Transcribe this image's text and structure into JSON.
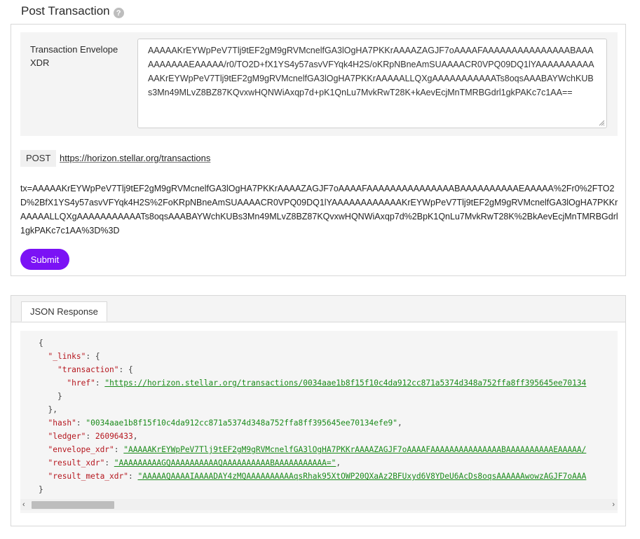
{
  "page": {
    "title": "Post Transaction",
    "help_glyph": "?"
  },
  "xdr": {
    "label": "Transaction Envelope XDR",
    "value": "AAAAAKrEYWpPeV7Tlj9tEF2gM9gRVMcnelfGA3lOgHA7PKKrAAAAZAGJF7oAAAAFAAAAAAAAAAAAAAABAAAAAAAAAAEAAAAA/r0/TO2D+fX1YS4y57asvVFYqk4H2S/oKRpNBneAmSUAAAACR0VPQ09DQ1lYAAAAAAAAAAAAKrEYWpPeV7Tlj9tEF2gM9gRVMcnelfGA3lOgHA7PKKrAAAAALLQXgAAAAAAAAAAATs8oqsAAABAYWchKUBs3Mn49MLvZ8BZ87KQvxwHQNWiAxqp7d+pK1QnLu7MvkRwT28K+kAevEcjMnTMRBGdrl1gkPAKc7c1AA=="
  },
  "request": {
    "method": "POST",
    "url": "https://horizon.stellar.org/transactions",
    "body": "tx=AAAAAKrEYWpPeV7Tlj9tEF2gM9gRVMcnelfGA3lOgHA7PKKrAAAAZAGJF7oAAAAFAAAAAAAAAAAAAAABAAAAAAAAAAEAAAAA%2Fr0%2FTO2D%2BfX1YS4y57asvVFYqk4H2S%2FoKRpNBneAmSUAAAACR0VPQ09DQ1lYAAAAAAAAAAAAKrEYWpPeV7Tlj9tEF2gM9gRVMcnelfGA3lOgHA7PKKrAAAAALLQXgAAAAAAAAAAATs8oqsAAABAYWchKUBs3Mn49MLvZ8BZ87KQvxwHQNWiAxqp7d%2BpK1QnLu7MvkRwT28K%2BkAevEcjMnTMRBGdrl1gkPAKc7c1AA%3D%3D"
  },
  "submit_label": "Submit",
  "response": {
    "tab_label": "JSON Response",
    "open_brace": "{",
    "links_key": "\"_links\"",
    "transaction_key": "\"transaction\"",
    "href_key": "\"href\"",
    "href_value": "\"https://horizon.stellar.org/transactions/0034aae1b8f15f10c4da912cc871a5374d348a752ffa8ff395645ee70134",
    "hash_key": "\"hash\"",
    "hash_value": "\"0034aae1b8f15f10c4da912cc871a5374d348a752ffa8ff395645ee70134efe9\"",
    "ledger_key": "\"ledger\"",
    "ledger_value": "26096433",
    "envelope_key": "\"envelope_xdr\"",
    "envelope_value": "\"AAAAAKrEYWpPeV7Tlj9tEF2gM9gRVMcnelfGA3lOgHA7PKKrAAAAZAGJF7oAAAAFAAAAAAAAAAAAAAABAAAAAAAAAAEAAAAA/",
    "result_key": "\"result_xdr\"",
    "result_value": "\"AAAAAAAAAGQAAAAAAAAAAQAAAAAAAAAABAAAAAAAAAAA=\"",
    "meta_key": "\"result_meta_xdr\"",
    "meta_value": "\"AAAAAQAAAAIAAAADAY4zMQAAAAAAAAAAqsRhak95XtOWP20QXaAz2BFUxyd6V8YDeU6AcDs8oqsAAAAAAwowzAGJF7oAAA",
    "close_brace": "}"
  },
  "scroll": {
    "left_arrow": "‹",
    "right_arrow": "›"
  }
}
